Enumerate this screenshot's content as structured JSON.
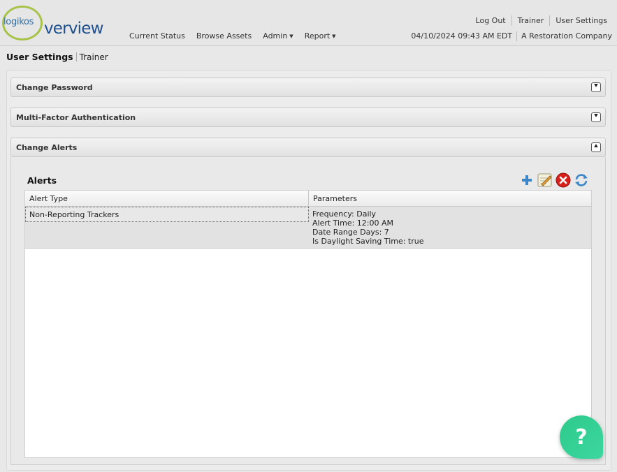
{
  "brand": {
    "logo_small": "logikos",
    "logo_large": "verview"
  },
  "nav": {
    "items": [
      {
        "label": "Current Status",
        "dropdown": false
      },
      {
        "label": "Browse Assets",
        "dropdown": false
      },
      {
        "label": "Admin",
        "dropdown": true
      },
      {
        "label": "Report",
        "dropdown": true
      }
    ]
  },
  "top_links": [
    "Log Out",
    "Trainer",
    "User Settings"
  ],
  "status": {
    "datetime": "04/10/2024 09:43 AM EDT",
    "company": "A Restoration Company"
  },
  "breadcrumb": {
    "title": "User Settings",
    "sub": "Trainer"
  },
  "sections": {
    "change_password": {
      "title": "Change Password",
      "expanded": false
    },
    "mfa": {
      "title": "Multi-Factor Authentication",
      "expanded": false
    },
    "change_alerts": {
      "title": "Change Alerts",
      "expanded": true
    }
  },
  "alerts": {
    "title": "Alerts",
    "columns": [
      "Alert Type",
      "Parameters"
    ],
    "rows": [
      {
        "alert_type": "Non-Reporting Trackers",
        "parameters": [
          "Frequency: Daily",
          "Alert Time: 12:00 AM",
          "Date Range Days: 7",
          "Is Daylight Saving Time: true"
        ]
      }
    ]
  },
  "toolbar_icons": [
    "add-icon",
    "edit-icon",
    "delete-icon",
    "refresh-icon"
  ],
  "help": {
    "label": "?"
  },
  "colors": {
    "logo_ring": "#a8c34a",
    "logo_text": "#1e4f8c",
    "help_button": "#2ec98a",
    "delete_red": "#d9201b",
    "add_blue": "#3a86c8"
  }
}
